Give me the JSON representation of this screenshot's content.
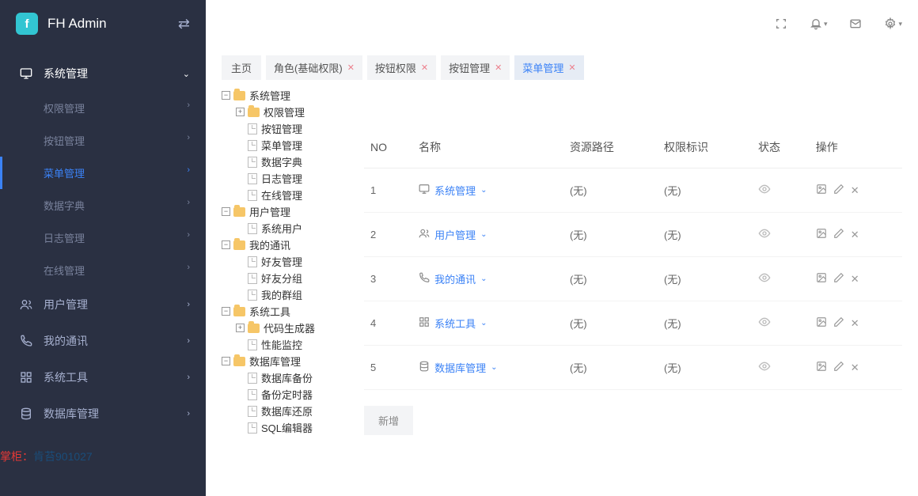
{
  "brand": {
    "name": "FH Admin",
    "logo_letter": "f"
  },
  "sidebar": [
    {
      "label": "系统管理",
      "icon": "monitor",
      "open": true,
      "children": [
        {
          "label": "权限管理"
        },
        {
          "label": "按钮管理"
        },
        {
          "label": "菜单管理",
          "active": true
        },
        {
          "label": "数据字典"
        },
        {
          "label": "日志管理"
        },
        {
          "label": "在线管理"
        }
      ]
    },
    {
      "label": "用户管理",
      "icon": "users"
    },
    {
      "label": "我的通讯",
      "icon": "phone"
    },
    {
      "label": "系统工具",
      "icon": "grid"
    },
    {
      "label": "数据库管理",
      "icon": "db"
    }
  ],
  "tabs": [
    {
      "label": "主页",
      "home": true
    },
    {
      "label": "角色(基础权限)"
    },
    {
      "label": "按钮权限"
    },
    {
      "label": "按钮管理"
    },
    {
      "label": "菜单管理",
      "active": true
    }
  ],
  "tree": [
    {
      "l": 1,
      "t": "minus",
      "i": "fld",
      "label": "系统管理"
    },
    {
      "l": 2,
      "t": "plus",
      "i": "fld",
      "label": "权限管理"
    },
    {
      "l": 2,
      "t": "none",
      "i": "fil",
      "label": "按钮管理"
    },
    {
      "l": 2,
      "t": "none",
      "i": "fil",
      "label": "菜单管理"
    },
    {
      "l": 2,
      "t": "none",
      "i": "fil",
      "label": "数据字典"
    },
    {
      "l": 2,
      "t": "none",
      "i": "fil",
      "label": "日志管理"
    },
    {
      "l": 2,
      "t": "none",
      "i": "fil",
      "label": "在线管理"
    },
    {
      "l": 1,
      "t": "minus",
      "i": "fld",
      "label": "用户管理"
    },
    {
      "l": 2,
      "t": "none",
      "i": "fil",
      "label": "系统用户"
    },
    {
      "l": 1,
      "t": "minus",
      "i": "fld",
      "label": "我的通讯"
    },
    {
      "l": 2,
      "t": "none",
      "i": "fil",
      "label": "好友管理"
    },
    {
      "l": 2,
      "t": "none",
      "i": "fil",
      "label": "好友分组"
    },
    {
      "l": 2,
      "t": "none",
      "i": "fil",
      "label": "我的群组"
    },
    {
      "l": 1,
      "t": "minus",
      "i": "fld",
      "label": "系统工具"
    },
    {
      "l": 2,
      "t": "plus",
      "i": "fld",
      "label": "代码生成器"
    },
    {
      "l": 2,
      "t": "none",
      "i": "fil",
      "label": "性能监控"
    },
    {
      "l": 1,
      "t": "minus",
      "i": "fld",
      "label": "数据库管理"
    },
    {
      "l": 2,
      "t": "none",
      "i": "fil",
      "label": "数据库备份"
    },
    {
      "l": 2,
      "t": "none",
      "i": "fil",
      "label": "备份定时器"
    },
    {
      "l": 2,
      "t": "none",
      "i": "fil",
      "label": "数据库还原"
    },
    {
      "l": 2,
      "t": "none",
      "i": "fil",
      "label": "SQL编辑器"
    }
  ],
  "table": {
    "headers": {
      "no": "NO",
      "name": "名称",
      "path": "资源路径",
      "perm": "权限标识",
      "state": "状态",
      "ops": "操作"
    },
    "rows": [
      {
        "no": "1",
        "name": "系统管理",
        "icon": "monitor",
        "path": "(无)",
        "perm": "(无)"
      },
      {
        "no": "2",
        "name": "用户管理",
        "icon": "users",
        "path": "(无)",
        "perm": "(无)"
      },
      {
        "no": "3",
        "name": "我的通讯",
        "icon": "phone",
        "path": "(无)",
        "perm": "(无)"
      },
      {
        "no": "4",
        "name": "系统工具",
        "icon": "grid",
        "path": "(无)",
        "perm": "(无)"
      },
      {
        "no": "5",
        "name": "数据库管理",
        "icon": "db",
        "path": "(无)",
        "perm": "(无)"
      }
    ],
    "new_label": "新增"
  },
  "watermark": {
    "p1": "掌柜：",
    "p2": "肯苔901027"
  }
}
